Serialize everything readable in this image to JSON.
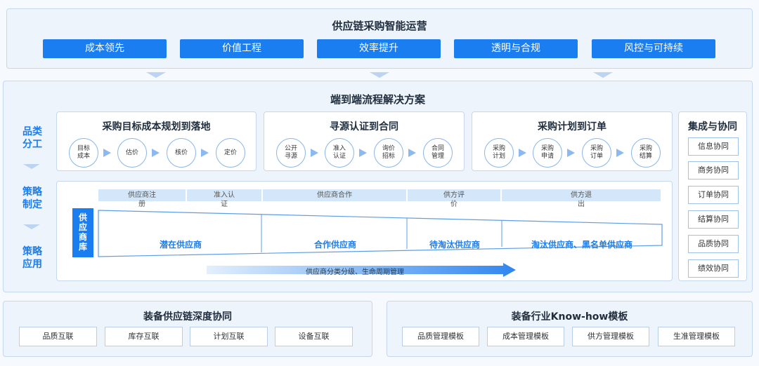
{
  "top": {
    "title": "供应链采购智能运营",
    "goals": [
      "成本领先",
      "价值工程",
      "效率提升",
      "透明与合规",
      "风控与可持续"
    ]
  },
  "middle": {
    "title": "端到端流程解决方案",
    "side_labels": [
      "品类\n分工",
      "策略\n制定",
      "策略\n应用"
    ],
    "processes": [
      {
        "title": "采购目标成本规划到落地",
        "steps": [
          "目标\n成本",
          "估价",
          "核价",
          "定价"
        ]
      },
      {
        "title": "寻源认证到合同",
        "steps": [
          "公开\n寻源",
          "准入\n认证",
          "询价\n招标",
          "合同\n管理"
        ]
      },
      {
        "title": "采购计划到订单",
        "steps": [
          "采购\n计划",
          "采购\n申请",
          "采购\n订单",
          "采购\n结算"
        ]
      }
    ],
    "integration": {
      "title": "集成与协同",
      "items": [
        "信息协同",
        "商务协同",
        "订单协同",
        "结算协同",
        "品质协同",
        "绩效协同"
      ]
    },
    "supplier_library": {
      "label": "供\n应\n商\n库",
      "stages": [
        "供应商注\n册",
        "准入认\n证",
        "供应商合作",
        "供方评\n价",
        "供方退\n出"
      ],
      "categories": [
        "潜在供应商",
        "合作供应商",
        "待淘汰供应商",
        "淘汰供应商、黑名单供应商"
      ],
      "lifecycle": "供应商分类分级、生命周期管理"
    }
  },
  "bottom_left": {
    "title": "装备供应链深度协同",
    "items": [
      "品质互联",
      "库存互联",
      "计划互联",
      "设备互联"
    ]
  },
  "bottom_right": {
    "title": "装备行业Know-how模板",
    "items": [
      "品质管理模板",
      "成本管理模板",
      "供方管理模板",
      "生准管理模板"
    ]
  },
  "colors": {
    "primary_blue": "#1a7ef0",
    "panel_bg": "#eef4fc",
    "header_bar": "#d4e6f9"
  }
}
